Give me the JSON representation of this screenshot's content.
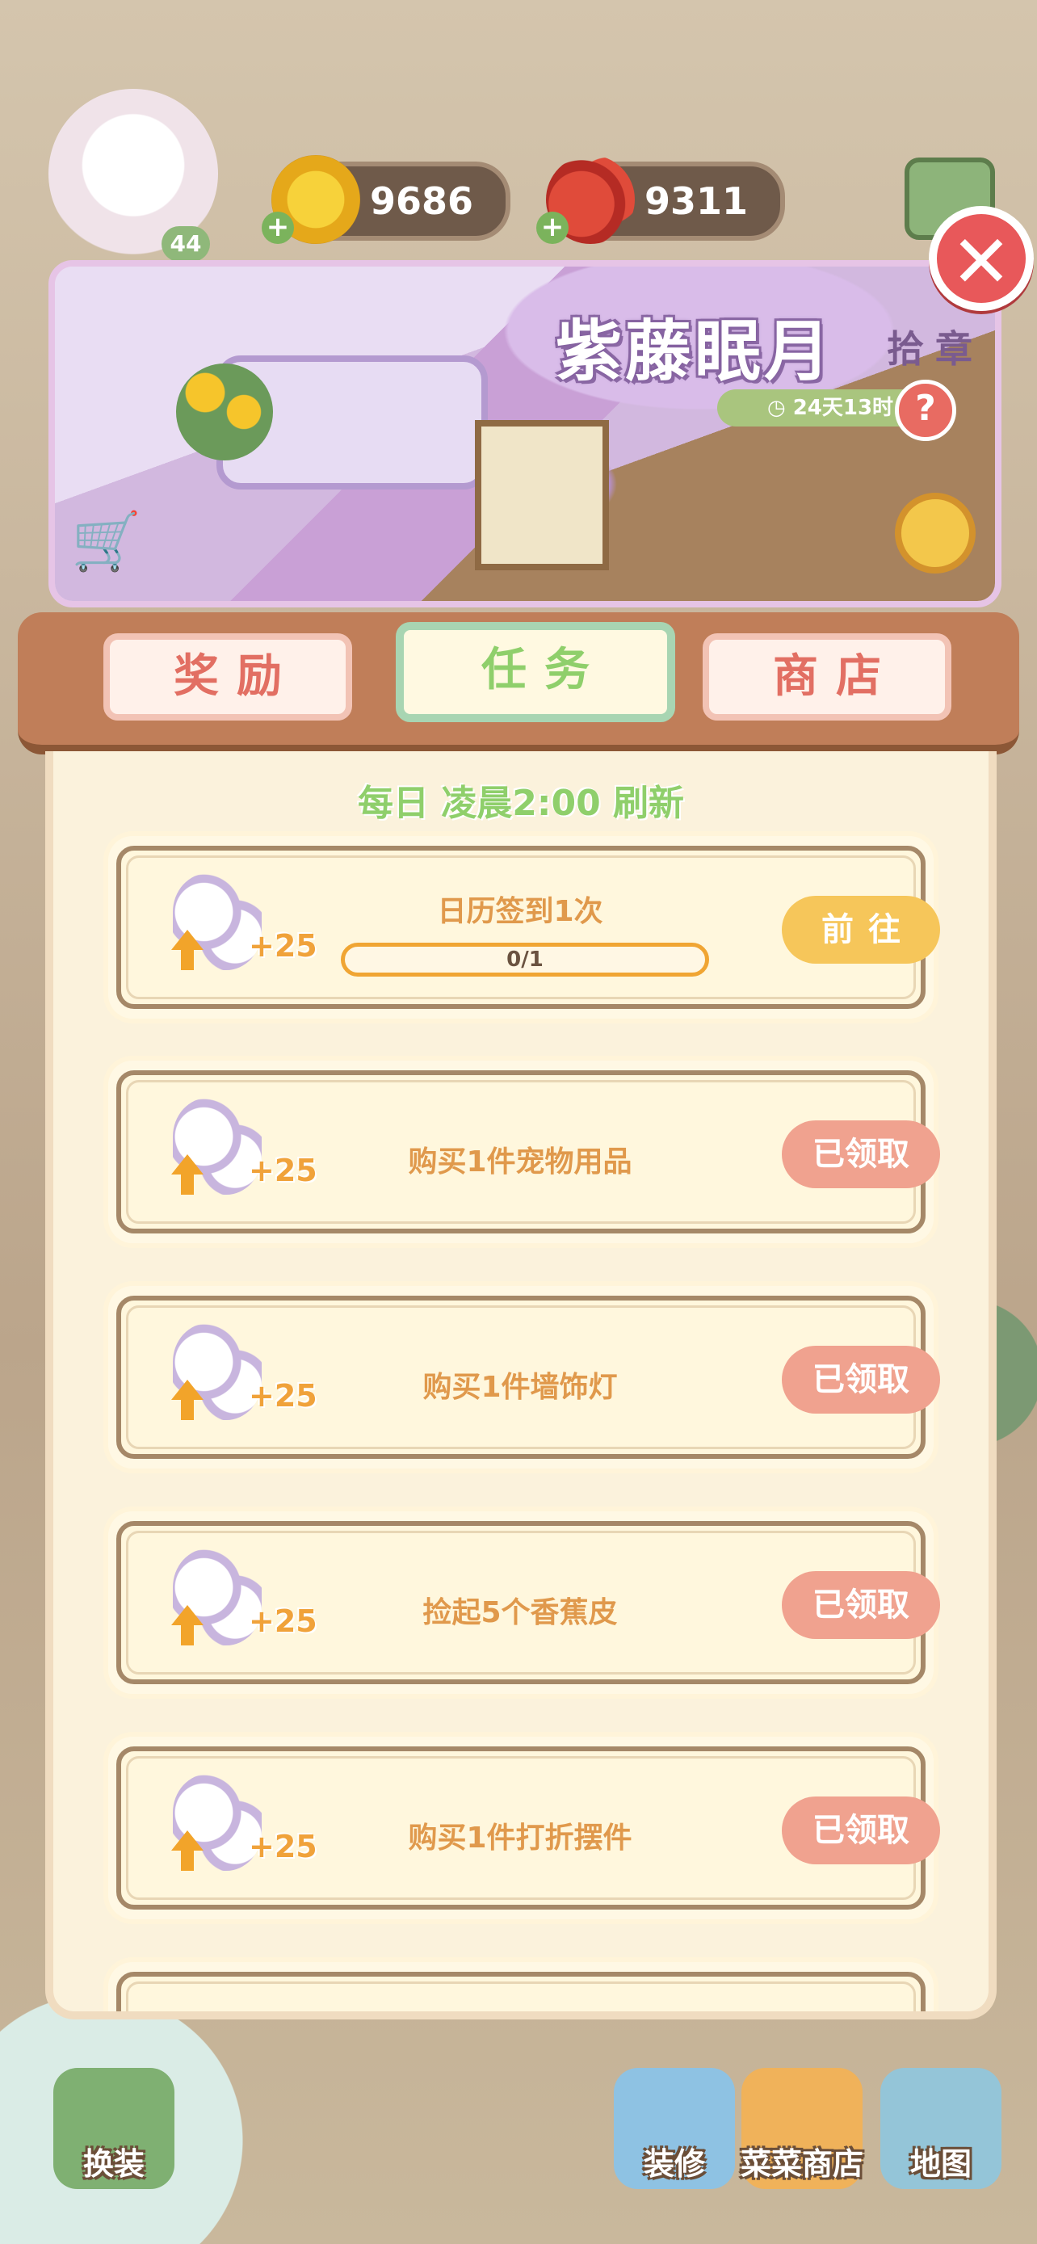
{
  "hud": {
    "avatar_level": "44",
    "gold_count": "9686",
    "tomato_count": "9311"
  },
  "banner": {
    "title": "紫藤眠月",
    "subtitle": "拾章",
    "timer": "24天13时",
    "help": "?"
  },
  "tabs": [
    {
      "label": "奖励",
      "active": false
    },
    {
      "label": "任务",
      "active": true
    },
    {
      "label": "商店",
      "active": false
    }
  ],
  "refresh_notice": "每日 凌晨2:00 刷新",
  "tasks": [
    {
      "reward": "+25",
      "name": "日历签到1次",
      "progress": "0/1",
      "button": "前往",
      "state": "go"
    },
    {
      "reward": "+25",
      "name": "购买1件宠物用品",
      "button": "已领取",
      "state": "claimed"
    },
    {
      "reward": "+25",
      "name": "购买1件墙饰灯",
      "button": "已领取",
      "state": "claimed"
    },
    {
      "reward": "+25",
      "name": "捡起5个香蕉皮",
      "button": "已领取",
      "state": "claimed"
    },
    {
      "reward": "+25",
      "name": "购买1件打折摆件",
      "button": "已领取",
      "state": "claimed"
    }
  ],
  "dock": {
    "change": "换装",
    "decorate": "装修",
    "veg_shop": "菜菜商店",
    "map": "地图"
  },
  "colors": {
    "accent_green": "#8fcf6b",
    "tab_pink": "#e26f63",
    "button_go": "#f6c65a",
    "button_claimed": "#f0a28f"
  }
}
